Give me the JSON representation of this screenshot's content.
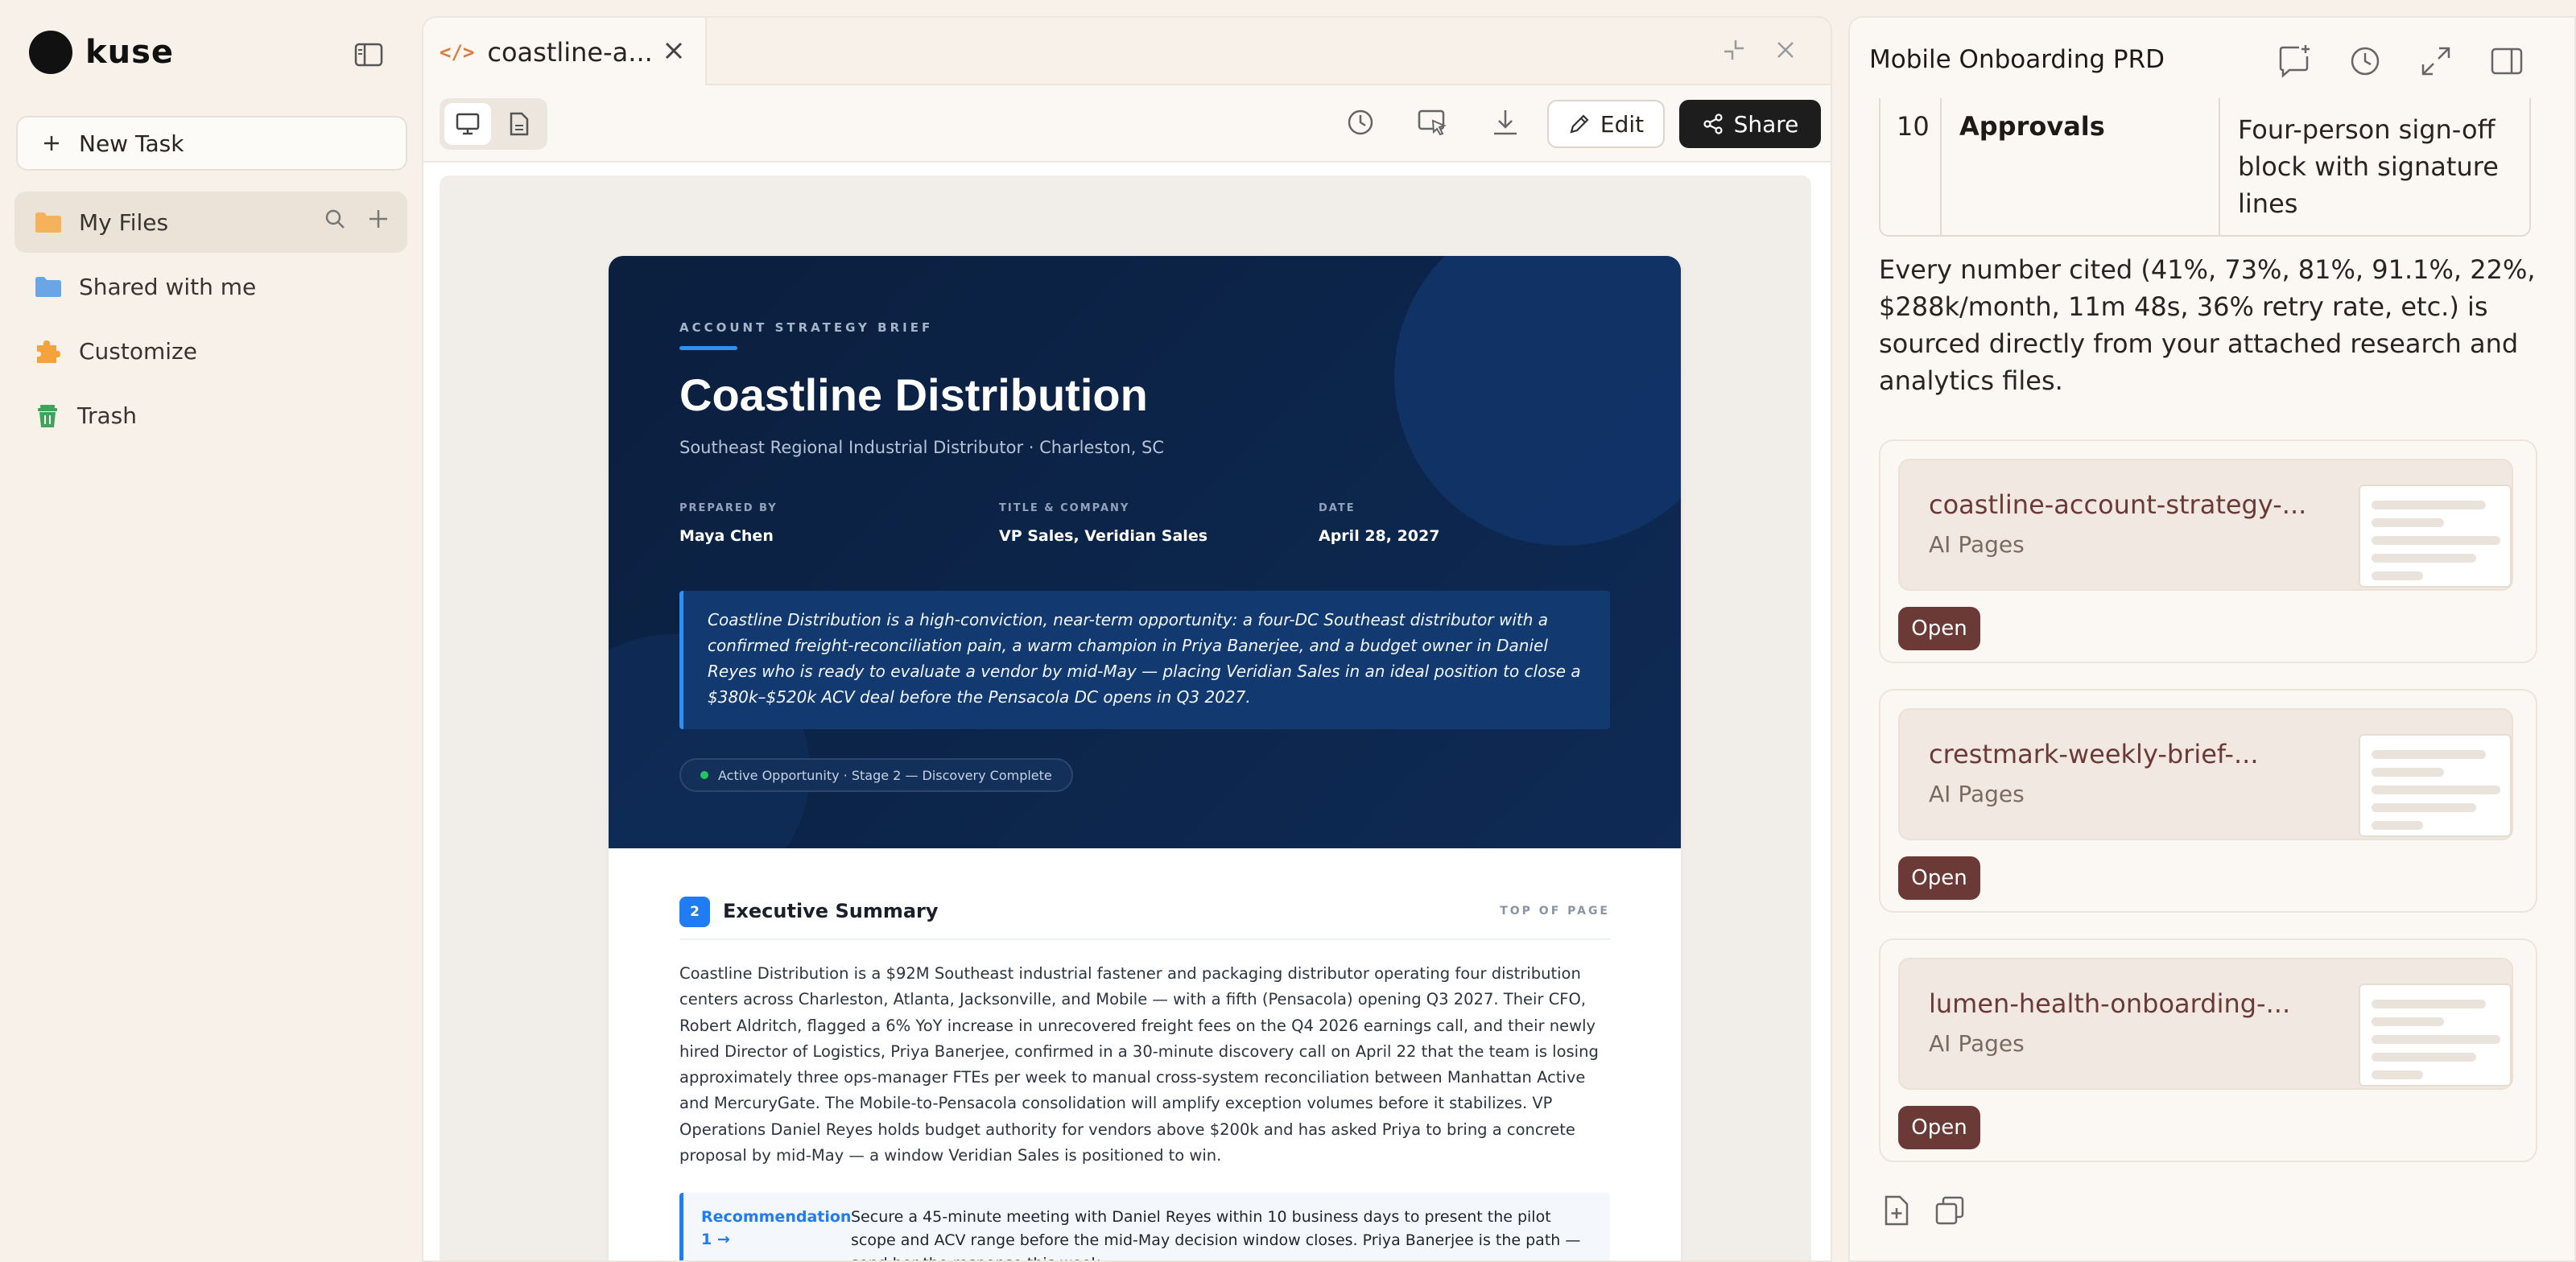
{
  "sidebar": {
    "brand": "kuse",
    "new_task": "New Task",
    "items": [
      {
        "label": "My Files",
        "icon": "folder-icon",
        "color": "#f3b25b"
      },
      {
        "label": "Shared with me",
        "icon": "shared-folder-icon",
        "color": "#6aa6e6"
      },
      {
        "label": "Customize",
        "icon": "puzzle-icon",
        "color": "#f2a33c"
      },
      {
        "label": "Trash",
        "icon": "trash-icon",
        "color": "#41a35b"
      }
    ]
  },
  "artifact": {
    "tab_title": "coastline-a...",
    "tab_code": "</>",
    "edit_label": "Edit",
    "share_label": "Share"
  },
  "doc": {
    "kicker": "ACCOUNT STRATEGY BRIEF",
    "title": "Coastline Distribution",
    "subtitle": "Southeast Regional Industrial Distributor  ·  Charleston, SC",
    "meta": [
      {
        "key": "PREPARED BY",
        "value": "Maya Chen"
      },
      {
        "key": "TITLE & COMPANY",
        "value": "VP Sales, Veridian Sales"
      },
      {
        "key": "DATE",
        "value": "April 28, 2027"
      }
    ],
    "quote": "Coastline Distribution is a high-conviction, near-term opportunity: a four-DC Southeast distributor with a confirmed freight-reconciliation pain, a warm champion in Priya Banerjee, and a budget owner in Daniel Reyes who is ready to evaluate a vendor by mid-May — placing Veridian Sales in an ideal position to close a $380k–$520k ACV deal before the Pensacola DC opens in Q3 2027.",
    "status": "Active Opportunity  ·  Stage 2 — Discovery Complete",
    "section_num": "2",
    "section_title": "Executive Summary",
    "section_top": "TOP OF PAGE",
    "summary": "Coastline Distribution is a $92M Southeast industrial fastener and packaging distributor operating four distribution centers across Charleston, Atlanta, Jacksonville, and Mobile — with a fifth (Pensacola) opening Q3 2027. Their CFO, Robert Aldritch, flagged a 6% YoY increase in unrecovered freight fees on the Q4 2026 earnings call, and their newly hired Director of Logistics, Priya Banerjee, confirmed in a 30-minute discovery call on April 22 that the team is losing approximately three ops-manager FTEs per week to manual cross-system reconciliation between Manhattan Active and MercuryGate. The Mobile-to-Pensacola consolidation will amplify exception volumes before it stabilizes. VP Operations Daniel Reyes holds budget authority for vendors above $200k and has asked Priya to bring a concrete proposal by mid-May — a window Veridian Sales is positioned to win.",
    "rec_label": "Recommendation 1 →",
    "rec_text": "Secure a 45-minute meeting with Daniel Reyes within 10 business days to present the pilot scope and ACV range before the mid-May decision window closes. Priya Banerjee is the path — send her the response this week."
  },
  "chat": {
    "title": "Mobile Onboarding PRD",
    "table_row": {
      "num": "10",
      "key": "Approvals",
      "value": "Four-person sign-off block with signature lines"
    },
    "paragraph": "Every number cited (41%, 73%, 81%, 91.1%, 22%, $288k/month, 11m 48s, 36% retry rate, etc.) is sourced directly from your attached research and analytics files.",
    "files": [
      {
        "name": "coastline-account-strategy-...",
        "type": "AI Pages",
        "open": "Open"
      },
      {
        "name": "crestmark-weekly-brief-...",
        "type": "AI Pages",
        "open": "Open"
      },
      {
        "name": "lumen-health-onboarding-...",
        "type": "AI Pages",
        "open": "Open"
      }
    ]
  },
  "colors": {
    "accent_blue": "#1f7cf1",
    "hero_navy": "#0b1f3e",
    "open_button": "#6b3a36",
    "share_button": "#1d1d1d"
  }
}
